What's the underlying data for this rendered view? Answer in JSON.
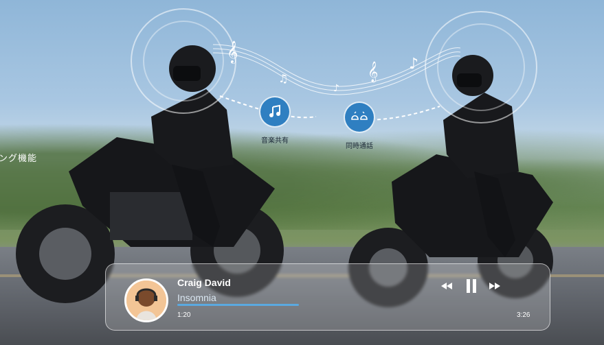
{
  "side_text": "ング機能",
  "features": [
    {
      "label": "音楽共有",
      "icon": "music-notes-icon"
    },
    {
      "label": "同時通話",
      "icon": "helmets-talk-icon"
    }
  ],
  "player": {
    "artist": "Craig David",
    "song": "Insomnia",
    "elapsed": "1:20",
    "total": "3:26",
    "progress": 0.39,
    "accent": "#5aa9e0"
  }
}
